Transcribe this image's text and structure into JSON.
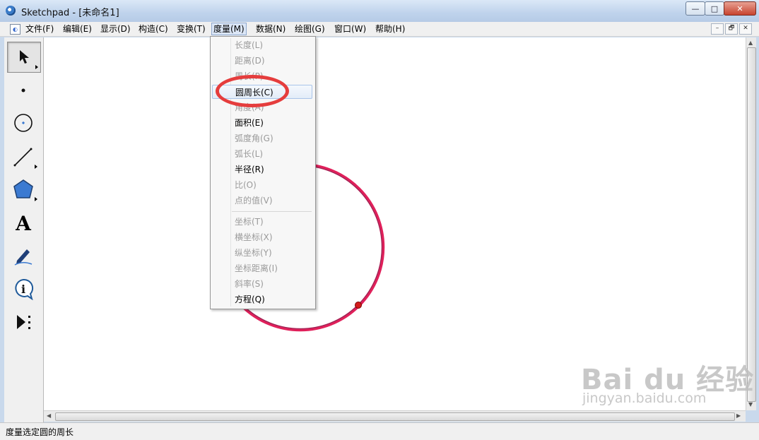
{
  "window": {
    "title": "Sketchpad  - [未命名1]",
    "min_label": "—",
    "max_label": "□",
    "close_label": "✕"
  },
  "menubar": {
    "items": [
      "文件(F)",
      "编辑(E)",
      "显示(D)",
      "构造(C)",
      "变换(T)",
      "度量(M)",
      "数据(N)",
      "绘图(G)",
      "窗口(W)",
      "帮助(H)"
    ],
    "active": "度量(M)",
    "mdi": [
      "–",
      "🗗",
      "✕"
    ]
  },
  "toolbox": {
    "tools": [
      "selection-arrow",
      "point",
      "compass",
      "straightedge",
      "polygon",
      "text",
      "marker",
      "information",
      "custom-tools"
    ],
    "text_tool_glyph": "A",
    "info_glyph": "i",
    "selected": "selection-arrow"
  },
  "dropdown": {
    "items": [
      {
        "label": "长度(L)",
        "enabled": false
      },
      {
        "label": "距离(D)",
        "enabled": false
      },
      {
        "label": "周长(P)",
        "enabled": false
      },
      {
        "label": "圆周长(C)",
        "enabled": true,
        "hover": true
      },
      {
        "label": "角度(A)",
        "enabled": false
      },
      {
        "label": "面积(E)",
        "enabled": true
      },
      {
        "label": "弧度角(G)",
        "enabled": false
      },
      {
        "label": "弧长(L)",
        "enabled": false
      },
      {
        "label": "半径(R)",
        "enabled": true
      },
      {
        "label": "比(O)",
        "enabled": false
      },
      {
        "label": "点的值(V)",
        "enabled": false
      },
      {
        "label": "坐标(T)",
        "enabled": false
      },
      {
        "label": "横坐标(X)",
        "enabled": false
      },
      {
        "label": "纵坐标(Y)",
        "enabled": false
      },
      {
        "label": "坐标距离(I)",
        "enabled": false
      },
      {
        "label": "斜率(S)",
        "enabled": false
      },
      {
        "label": "方程(Q)",
        "enabled": true
      }
    ]
  },
  "canvas": {
    "circle_color": "#e0205a",
    "point_color": "#d41c1c"
  },
  "statusbar": {
    "text": "度量选定圆的周长"
  },
  "watermark": {
    "brand": "Bai du 经验",
    "url": "jingyan.baidu.com"
  }
}
